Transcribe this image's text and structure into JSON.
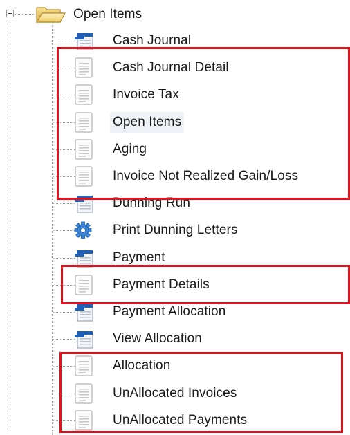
{
  "tree": {
    "root": {
      "label": "Open Items",
      "icon": "folder-open-icon",
      "expander": "minus",
      "expanded": true
    },
    "items": [
      {
        "label": "Cash Journal",
        "icon": "form-icon"
      },
      {
        "label": "Cash Journal Detail",
        "icon": "report-page-icon"
      },
      {
        "label": "Invoice Tax",
        "icon": "report-page-icon"
      },
      {
        "label": "Open Items",
        "icon": "report-page-icon",
        "selected": true
      },
      {
        "label": "Aging",
        "icon": "report-page-icon"
      },
      {
        "label": "Invoice Not Realized Gain/Loss",
        "icon": "report-page-icon"
      },
      {
        "label": "Dunning Run",
        "icon": "form-icon"
      },
      {
        "label": "Print Dunning Letters",
        "icon": "gear-icon"
      },
      {
        "label": "Payment",
        "icon": "form-icon"
      },
      {
        "label": "Payment Details",
        "icon": "report-page-icon"
      },
      {
        "label": "Payment Allocation",
        "icon": "form-icon"
      },
      {
        "label": "View Allocation",
        "icon": "form-icon"
      },
      {
        "label": "Allocation",
        "icon": "report-page-icon"
      },
      {
        "label": "UnAllocated Invoices",
        "icon": "report-page-icon"
      },
      {
        "label": "UnAllocated Payments",
        "icon": "report-page-icon"
      }
    ]
  },
  "highlight": {
    "color": "#e0121b"
  }
}
